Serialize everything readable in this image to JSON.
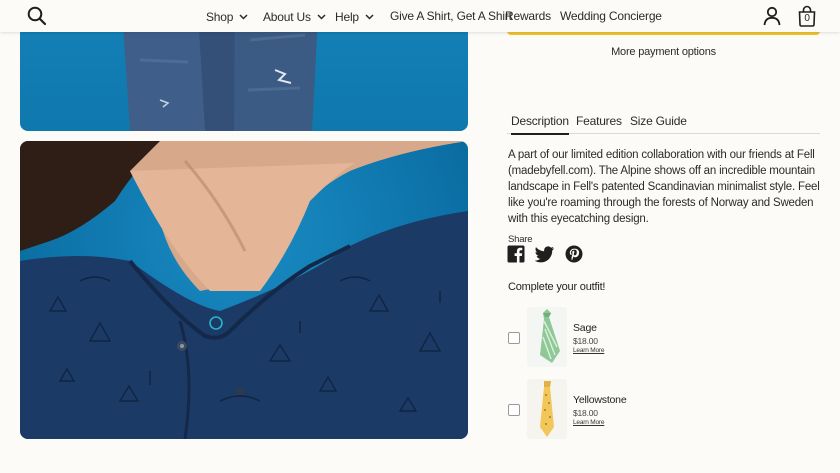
{
  "header": {
    "nav": [
      {
        "label": "Shop",
        "has_dropdown": true
      },
      {
        "label": "About Us",
        "has_dropdown": true
      },
      {
        "label": "Help",
        "has_dropdown": true
      },
      {
        "label": "Give A Shirt, Get A Shirt",
        "has_dropdown": false
      },
      {
        "label": "Rewards",
        "has_dropdown": false
      },
      {
        "label": "Wedding Concierge",
        "has_dropdown": false
      }
    ],
    "cart_count": "0",
    "icons": [
      "search-icon",
      "account-icon",
      "cart-icon",
      "chevron-down-icon"
    ]
  },
  "product": {
    "more_payment_options": "More payment options",
    "payment_button_color": "#f4c430",
    "tabs": [
      {
        "label": "Description",
        "active": true
      },
      {
        "label": "Features",
        "active": false
      },
      {
        "label": "Size Guide",
        "active": false
      }
    ],
    "description": "A part of our limited edition collaboration with our friends at Fell (madebyfell.com). The Alpine shows off an incredible mountain landscape in Fell's patented Scandinavian minimalist style. Feel like you're roaming through the forests of Norway and Sweden with this eyecatching design.",
    "share": {
      "label": "Share",
      "icons": [
        "facebook-icon",
        "twitter-icon",
        "pinterest-icon"
      ]
    }
  },
  "complete_outfit": {
    "title": "Complete your outfit!",
    "items": [
      {
        "name": "Sage",
        "price": "$18.00",
        "link": "Learn More",
        "color": "#8fc796"
      },
      {
        "name": "Yellowstone",
        "price": "$18.00",
        "link": "Learn More",
        "color": "#f2c75a"
      }
    ]
  },
  "colors": {
    "background": "#fdfbf7",
    "photo_blue": "#1583b9",
    "shirt_navy": "#1c3a66"
  }
}
